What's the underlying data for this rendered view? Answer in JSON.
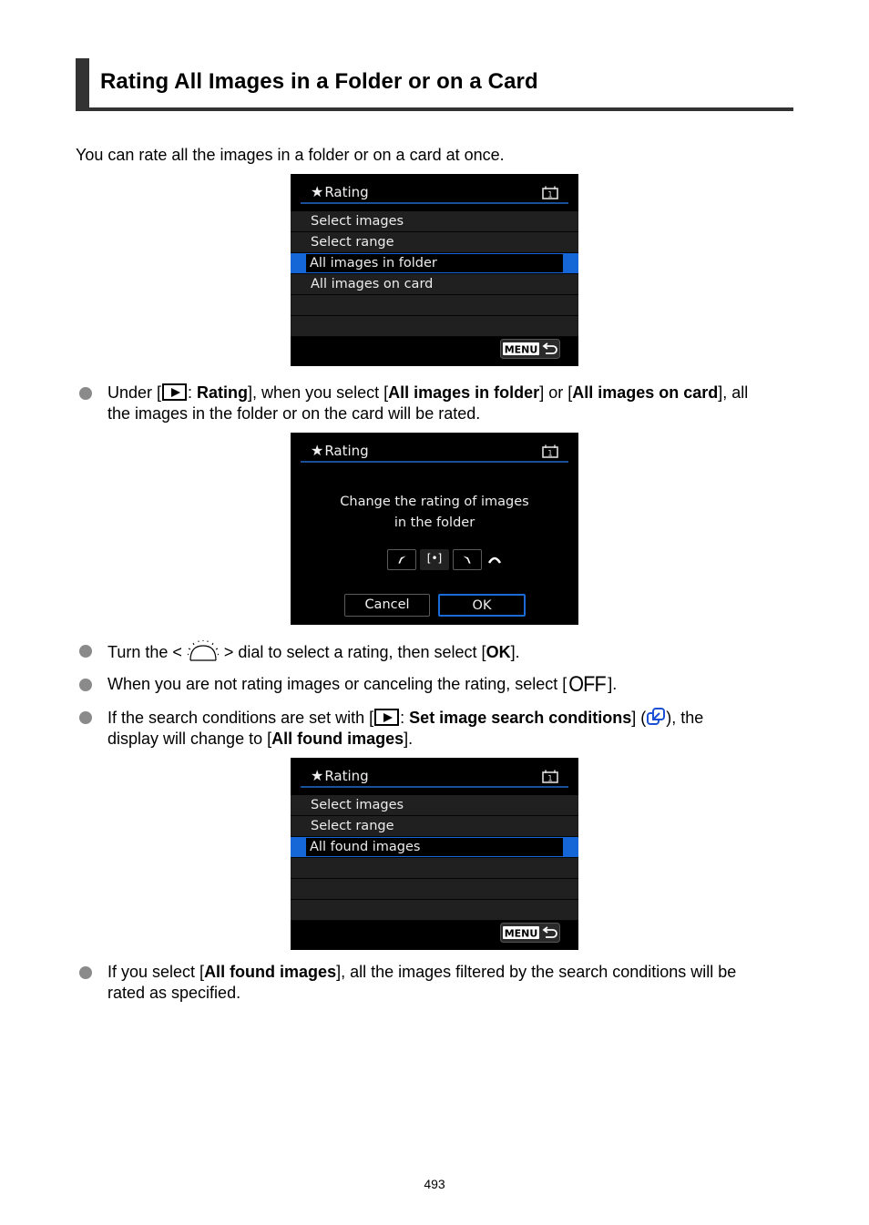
{
  "heading": "Rating All Images in a Folder or on a Card",
  "intro": "You can rate all the images in a folder or on a card at once.",
  "screen1": {
    "title": "Rating",
    "tab_number": "1",
    "rows": [
      "Select images",
      "Select range",
      "All images in folder",
      "All images on card",
      "",
      ""
    ],
    "selected_index": 2,
    "menu_button": "MENU"
  },
  "bullet1": {
    "t1": "Under [",
    "t2": ": ",
    "b1": "Rating",
    "t3": "], when you select [",
    "b2": "All images in folder",
    "t4": "] or [",
    "b3": "All images on card",
    "t5": "], all",
    "line2": "the images in the folder or on the card will be rated."
  },
  "screen2": {
    "title": "Rating",
    "tab_number": "1",
    "message_line1": "Change the rating of images",
    "message_line2": "in the folder",
    "rating_buttons": [
      "decrease",
      "[•]",
      "increase"
    ],
    "cancel_label": "Cancel",
    "ok_label": "OK"
  },
  "bullet2": {
    "t1": "Turn the < ",
    "t2": " > dial to select a rating, then select [",
    "b1": "OK",
    "t3": "]."
  },
  "bullet3": {
    "t1": "When you are not rating images or canceling the rating, select [",
    "off": "OFF",
    "t2": "]."
  },
  "bullet4": {
    "t1": "If the search conditions are set with [",
    "t2": ": ",
    "b1": "Set image search conditions",
    "t3": "] (",
    "t4": "), the",
    "line2_t1": "display will change to [",
    "line2_b1": "All found images",
    "line2_t2": "]."
  },
  "screen3": {
    "title": "Rating",
    "tab_number": "1",
    "rows": [
      "Select images",
      "Select range",
      "All found images",
      "",
      "",
      ""
    ],
    "selected_index": 2,
    "menu_button": "MENU"
  },
  "bullet5": {
    "t1": "If you select [",
    "b1": "All found images",
    "t2": "], all the images filtered by the search conditions will be",
    "line2": "rated as specified."
  },
  "page_number": "493",
  "colors": {
    "heading_bar": "#333333",
    "bullet": "#8a8a8a",
    "camera_highlight": "#1566d6",
    "link_icon": "#1a4fd6"
  }
}
